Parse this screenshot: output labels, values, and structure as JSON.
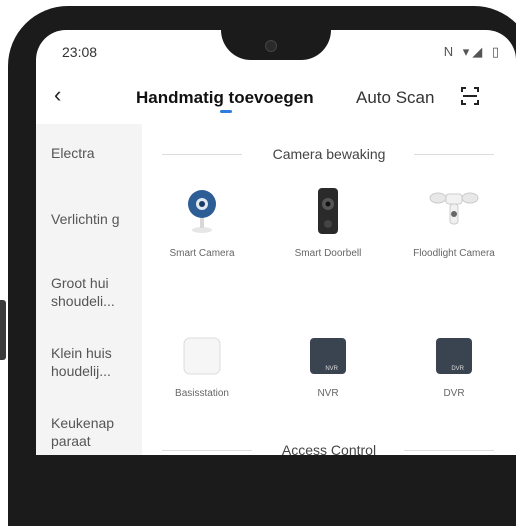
{
  "status": {
    "time": "23:08",
    "icons": "N ▾◢ ▯"
  },
  "header": {
    "back_glyph": "‹",
    "title": "Handmatig toevoegen",
    "auto_scan": "Auto Scan"
  },
  "nav": {
    "items": [
      {
        "label": "Electra"
      },
      {
        "label": "Verlichtin g"
      },
      {
        "label": "Groot hui shoudeli..."
      },
      {
        "label": "Klein huis houdelij..."
      },
      {
        "label": "Keukenap paraat"
      }
    ]
  },
  "sections": [
    {
      "title": "Camera bewaking",
      "devices": [
        {
          "label": "Smart Camera"
        },
        {
          "label": "Smart Doorbell"
        },
        {
          "label": "Floodlight Camera"
        },
        {
          "label": "Basisstation"
        },
        {
          "label": "NVR",
          "badge": "NVR"
        },
        {
          "label": "DVR",
          "badge": "DVR"
        }
      ]
    },
    {
      "title": "Access Control"
    }
  ],
  "colors": {
    "accent": "#2f7de1",
    "bezel": "#1b1b1b",
    "nav_bg": "#f4f4f4"
  }
}
